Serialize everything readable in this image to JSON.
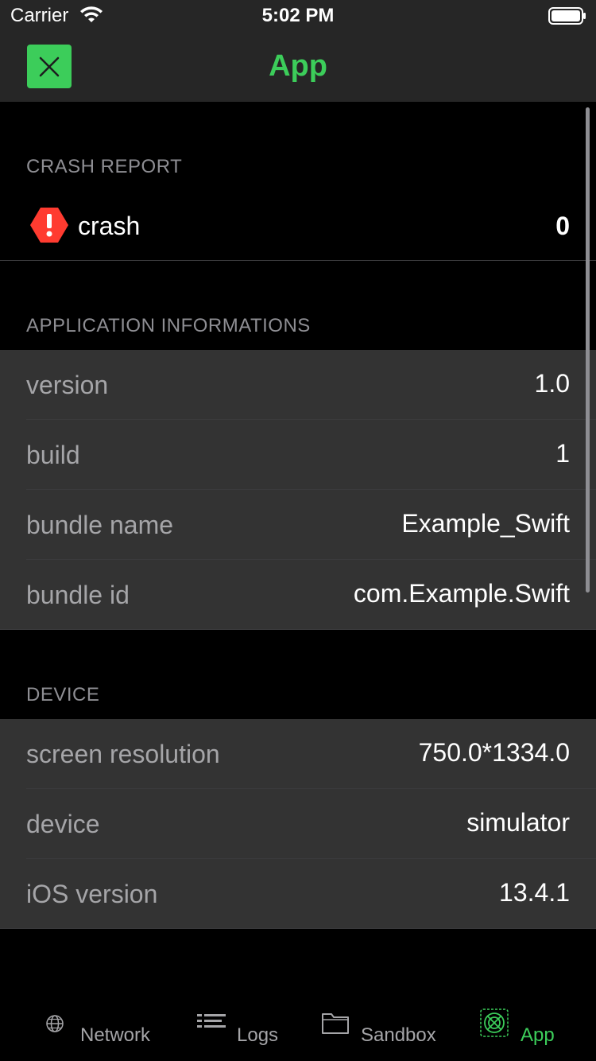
{
  "status_bar": {
    "carrier": "Carrier",
    "time": "5:02 PM"
  },
  "nav": {
    "title": "App",
    "close_icon": "close-icon",
    "accent_color": "#3ccd5a"
  },
  "sections": {
    "crash_report": {
      "header": "CRASH REPORT",
      "crash_label": "crash",
      "crash_count": "0",
      "icon": "warning-octagon-icon"
    },
    "application": {
      "header": "APPLICATION INFORMATIONS",
      "rows": [
        {
          "label": "version",
          "value": "1.0"
        },
        {
          "label": "build",
          "value": "1"
        },
        {
          "label": "bundle name",
          "value": "Example_Swift"
        },
        {
          "label": "bundle id",
          "value": "com.Example.Swift"
        }
      ]
    },
    "device": {
      "header": "DEVICE",
      "rows": [
        {
          "label": "screen resolution",
          "value": "750.0*1334.0"
        },
        {
          "label": "device",
          "value": "simulator"
        },
        {
          "label": "iOS version",
          "value": "13.4.1"
        }
      ]
    }
  },
  "tabs": [
    {
      "label": "Network",
      "icon": "globe-icon",
      "active": false
    },
    {
      "label": "Logs",
      "icon": "list-icon",
      "active": false
    },
    {
      "label": "Sandbox",
      "icon": "folder-icon",
      "active": false
    },
    {
      "label": "App",
      "icon": "app-icon",
      "active": true
    }
  ],
  "colors": {
    "accent": "#3ccd5a",
    "crash_red": "#ff3b30",
    "row_bg": "#333333",
    "header_text": "#8e8e93"
  }
}
